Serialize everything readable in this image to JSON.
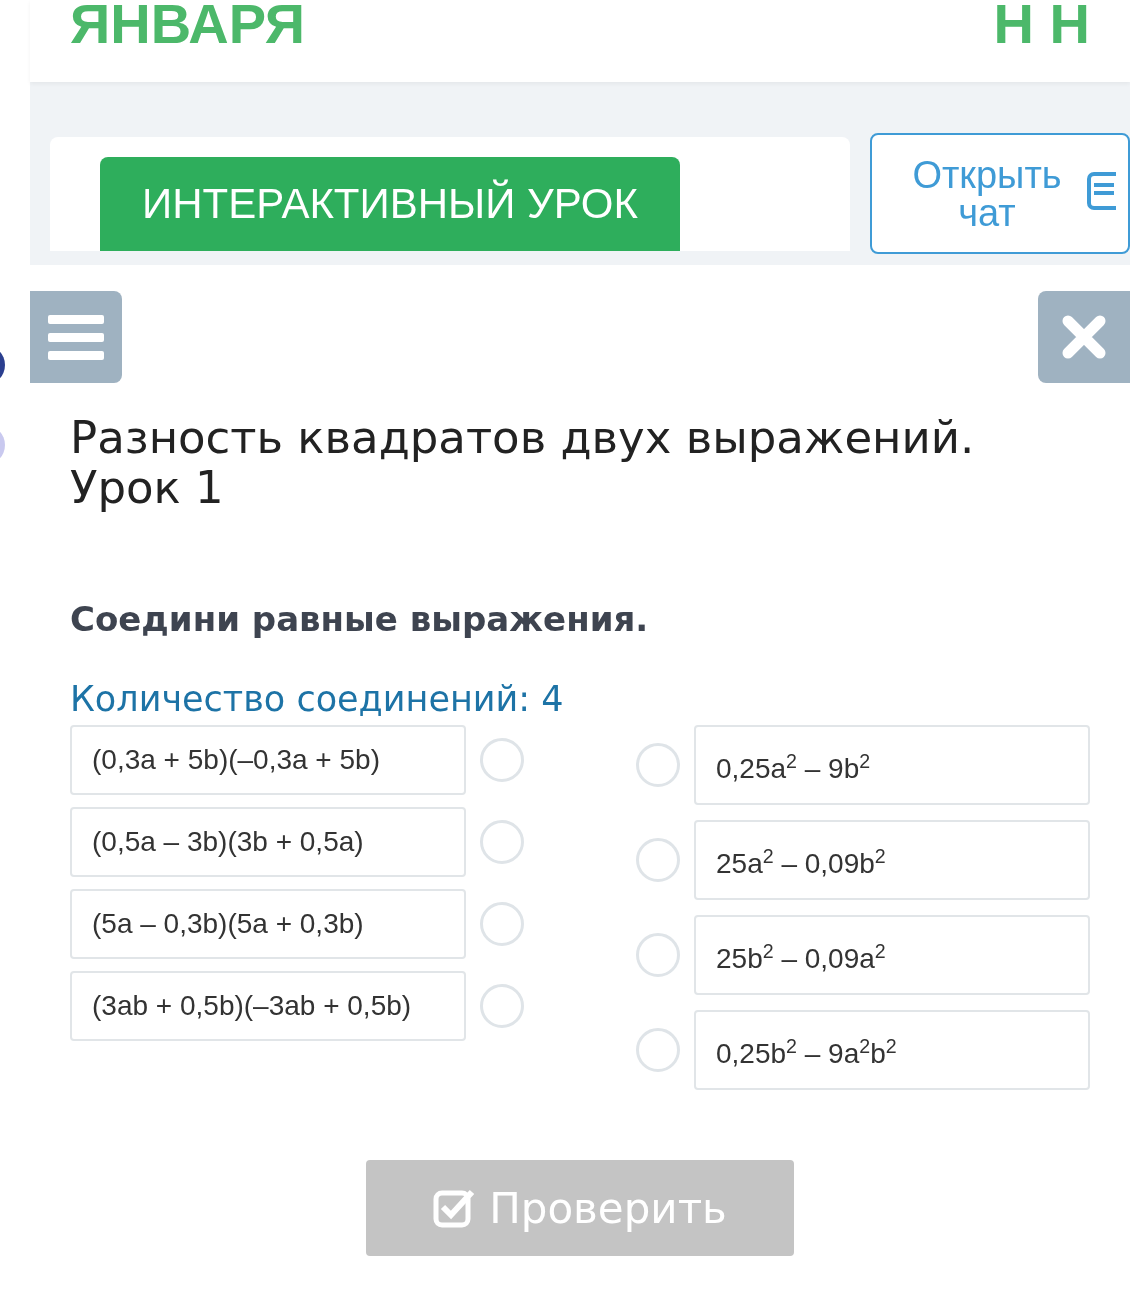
{
  "header": {
    "date_fragment": "ЯНВАРЯ",
    "user_initials": "Н Н"
  },
  "lesson_badge": "ИНТЕРАКТИВНЫЙ УРОК",
  "chat_button": "Открыть чат",
  "title": "Разность квадратов двух выражений. Урок 1",
  "task": "Соедини равные выражения.",
  "connections_label": "Количество соединений: 4",
  "left_items": [
    {
      "expression": "(0,3a + 5b)(–0,3a + 5b)",
      "selected": false
    },
    {
      "expression": "(0,5a – 3b)(3b + 0,5a)",
      "selected": false
    },
    {
      "expression": "(5a – 0,3b)(5a + 0,3b)",
      "selected": false
    },
    {
      "expression": "(3ab + 0,5b)(–3ab + 0,5b)",
      "selected": false
    }
  ],
  "right_items": [
    {
      "expression": "0,25a$^{2}$ – 9b$^{2}$",
      "selected": false
    },
    {
      "expression": "25a$^{2}$ – 0,09b$^{2}$",
      "selected": false
    },
    {
      "expression": "25b$^{2}$ – 0,09a$^{2}$",
      "selected": false
    },
    {
      "expression": "0,25b$^{2}$ – 9a$^{2}$b$^{2}$",
      "selected": false
    }
  ],
  "check_button": {
    "label": "Проверить",
    "disabled": true
  }
}
